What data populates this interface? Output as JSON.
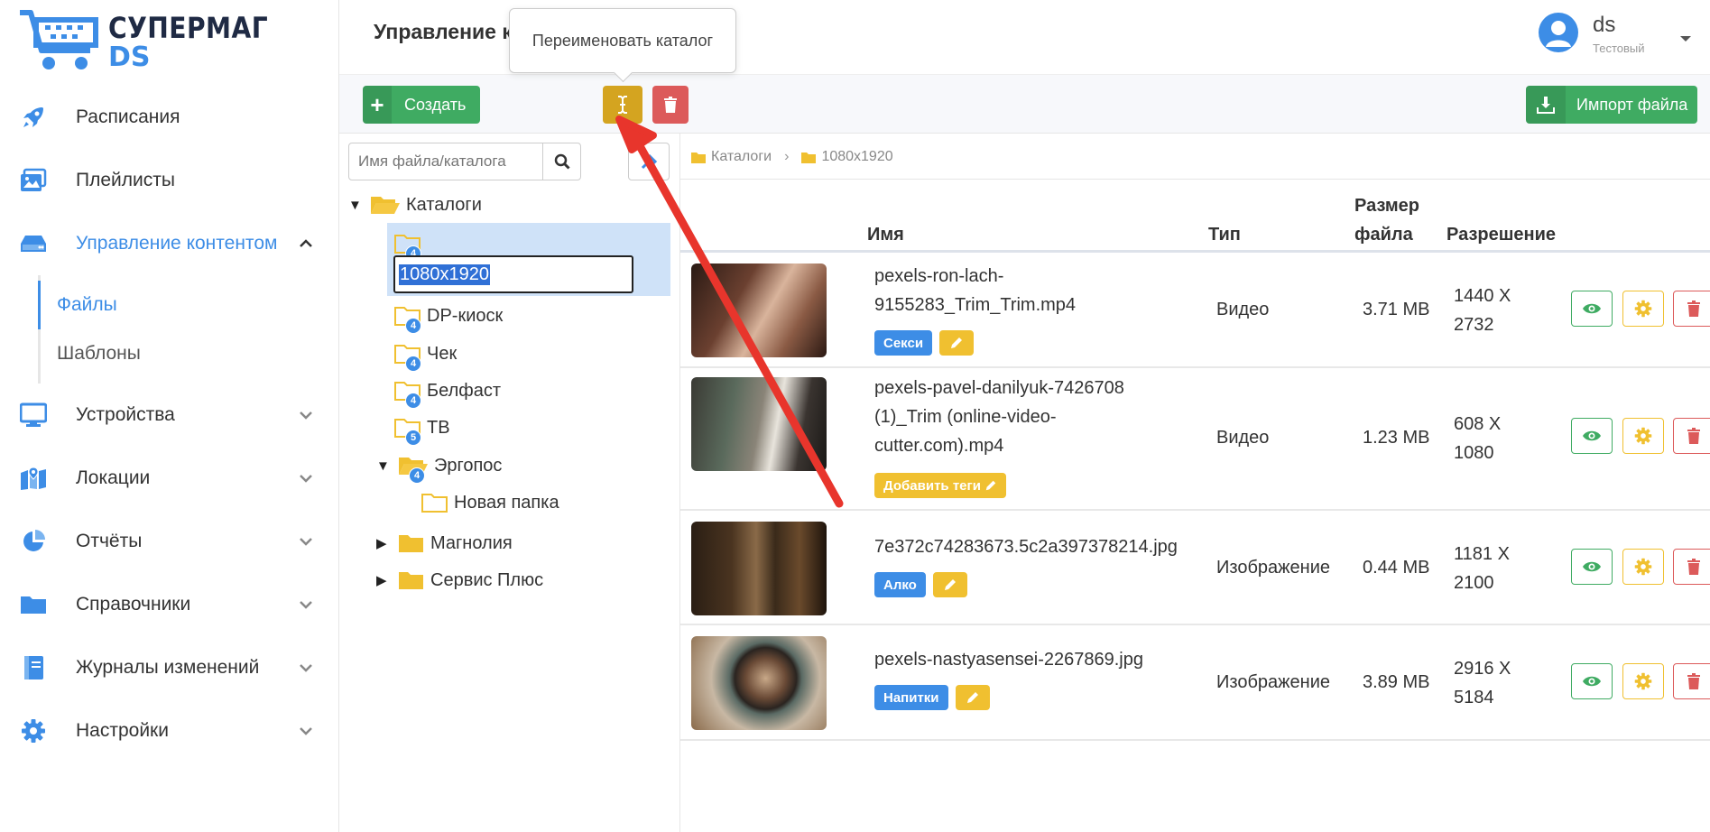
{
  "logo": {
    "line1": "СУПЕРМАГ",
    "line2": "DS"
  },
  "sidebar": {
    "items": [
      {
        "label": "Расписания",
        "icon": "rocket-icon"
      },
      {
        "label": "Плейлисты",
        "icon": "images-icon"
      },
      {
        "label": "Управление контентом",
        "icon": "hdd-icon",
        "expanded": true
      },
      {
        "label": "Устройства",
        "icon": "monitor-icon"
      },
      {
        "label": "Локации",
        "icon": "map-icon"
      },
      {
        "label": "Отчёты",
        "icon": "pie-chart-icon"
      },
      {
        "label": "Справочники",
        "icon": "folder-icon"
      },
      {
        "label": "Журналы изменений",
        "icon": "book-icon"
      },
      {
        "label": "Настройки",
        "icon": "gear-icon"
      }
    ],
    "sub_items": [
      {
        "label": "Файлы",
        "active": true
      },
      {
        "label": "Шаблоны",
        "active": false
      }
    ]
  },
  "header": {
    "title": "Управление к",
    "user_name": "ds",
    "user_role": "Тестовый"
  },
  "tooltip": "Переименовать каталог",
  "toolbar": {
    "create_label": "Создать",
    "import_label": "Импорт файла"
  },
  "tree": {
    "search_placeholder": "Имя файла/каталога",
    "root": "Каталоги",
    "rename_value": "1080x1920",
    "nodes": [
      {
        "label": "DP-киоск",
        "badge": "4"
      },
      {
        "label": "Чек",
        "badge": "4"
      },
      {
        "label": "Белфаст",
        "badge": "4"
      },
      {
        "label": "ТВ",
        "badge": "5"
      },
      {
        "label": "Эргопос",
        "badge": "4"
      },
      {
        "label": "Новая папка"
      },
      {
        "label": "Магнолия"
      },
      {
        "label": "Сервис Плюс"
      }
    ],
    "selected_badge": "4"
  },
  "breadcrumb": {
    "root": "Каталоги",
    "current": "1080x1920"
  },
  "table": {
    "headers": {
      "name": "Имя",
      "type": "Тип",
      "size_line1": "Размер",
      "size_line2": "файла",
      "resolution": "Разрешение"
    },
    "rows": [
      {
        "name_line1": "pexels-ron-lach-",
        "name_line2": "9155283_Trim_Trim.mp4",
        "name_line3": "",
        "tag": "Секси",
        "type": "Видео",
        "size": "3.71 MB",
        "res_w": "1440 X",
        "res_h": "2732"
      },
      {
        "name_line1": "pexels-pavel-danilyuk-7426708",
        "name_line2": "(1)_Trim (online-video-",
        "name_line3": "cutter.com).mp4",
        "tag": "Добавить теги",
        "type": "Видео",
        "size": "1.23 MB",
        "res_w": "608 X",
        "res_h": "1080"
      },
      {
        "name_line1": "7e372c74283673.5c2a397378214.jpg",
        "name_line2": "",
        "name_line3": "",
        "tag": "Алко",
        "type": "Изображение",
        "size": "0.44 MB",
        "res_w": "1181 X",
        "res_h": "2100"
      },
      {
        "name_line1": "pexels-nastyasensei-2267869.jpg",
        "name_line2": "",
        "name_line3": "",
        "tag": "Напитки",
        "type": "Изображение",
        "size": "3.89 MB",
        "res_w": "2916 X",
        "res_h": "5184"
      }
    ]
  },
  "colors": {
    "accent": "#3d8de6",
    "green": "#3fab62",
    "yellow": "#f0c030",
    "red": "#dc5a5a",
    "arrow": "#e8352c"
  }
}
